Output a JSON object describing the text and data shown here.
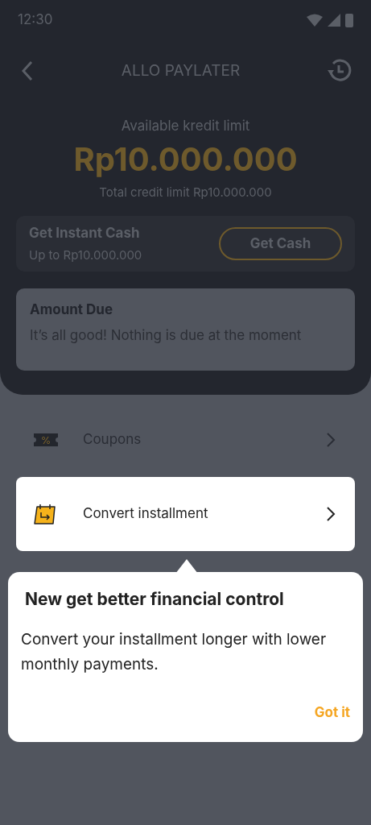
{
  "status_bar": {
    "time": "12:30"
  },
  "header": {
    "title": "ALLO PAYLATER"
  },
  "limit": {
    "label": "Available kredit limit",
    "amount": "Rp10.000.000",
    "total": "Total credit limit Rp10.000.000"
  },
  "instant_cash": {
    "title": "Get Instant Cash",
    "subtitle": "Up to Rp10.000.000",
    "button": "Get Cash"
  },
  "amount_due": {
    "title": "Amount Due",
    "message": "It’s all good! Nothing is due at the moment"
  },
  "menu": [
    {
      "kind": "coupon",
      "label": "Coupons",
      "highlighted": false
    },
    {
      "kind": "installment",
      "label": "Convert installment",
      "highlighted": true
    }
  ],
  "tooltip": {
    "title": "New get better financial control",
    "body": "Convert your installment longer with lower monthly payments.",
    "action": "Got it"
  }
}
